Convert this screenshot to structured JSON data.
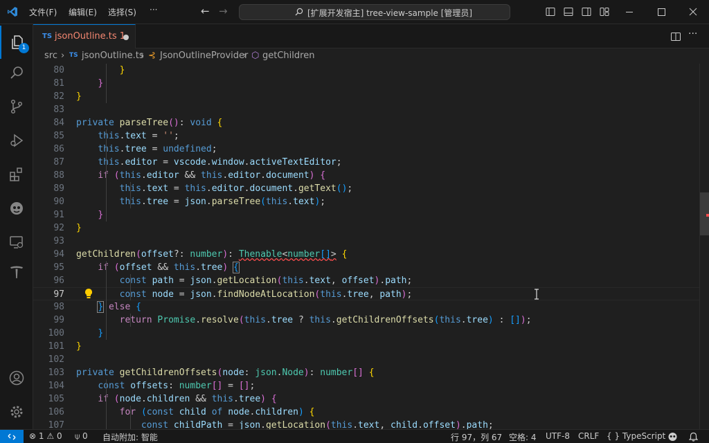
{
  "title_bar": {
    "menus": [
      "文件(F)",
      "编辑(E)",
      "选择(S)",
      "···"
    ],
    "search_text": "[扩展开发宿主] tree-view-sample [管理员]"
  },
  "activity_bar": {
    "explorer_badge": "1"
  },
  "tab": {
    "type_label": "TS",
    "file_name": "jsonOutline.ts",
    "problem_count": "1"
  },
  "breadcrumb": {
    "items": [
      "src",
      "jsonOutline.ts",
      "JsonOutlineProvider",
      "getChildren"
    ]
  },
  "editor": {
    "current_line": "97",
    "lines": [
      {
        "n": "80"
      },
      {
        "n": "81"
      },
      {
        "n": "82"
      },
      {
        "n": "83"
      },
      {
        "n": "84"
      },
      {
        "n": "85"
      },
      {
        "n": "86"
      },
      {
        "n": "87"
      },
      {
        "n": "88"
      },
      {
        "n": "89"
      },
      {
        "n": "90"
      },
      {
        "n": "91"
      },
      {
        "n": "92"
      },
      {
        "n": "93"
      },
      {
        "n": "94"
      },
      {
        "n": "95"
      },
      {
        "n": "96"
      },
      {
        "n": "97"
      },
      {
        "n": "98"
      },
      {
        "n": "99"
      },
      {
        "n": "100"
      },
      {
        "n": "101"
      },
      {
        "n": "102"
      },
      {
        "n": "103"
      },
      {
        "n": "104"
      },
      {
        "n": "105"
      },
      {
        "n": "106"
      },
      {
        "n": "107"
      }
    ]
  },
  "status_bar": {
    "errors": "1",
    "warnings": "0",
    "ports": "0",
    "auto_attach": "自动附加: 智能",
    "position": "行 97，列 67",
    "spaces": "空格: 4",
    "encoding": "UTF-8",
    "eol": "CRLF",
    "language": "{ } TypeScript"
  },
  "colors": {
    "accent": "#0078d4",
    "error": "#f14c4c",
    "keyword": "#569cd6",
    "function": "#dcdcaa"
  }
}
